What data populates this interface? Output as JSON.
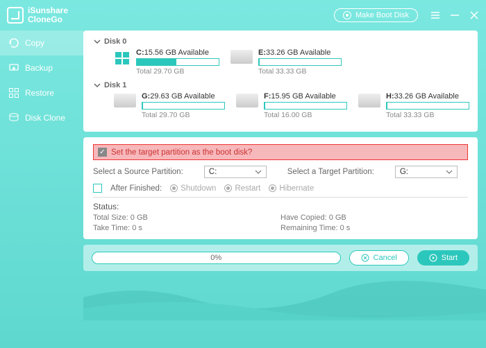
{
  "app": {
    "name_line1": "iSunshare",
    "name_line2": "CloneGo",
    "make_boot": "Make Boot Disk"
  },
  "nav": {
    "copy": "Copy",
    "backup": "Backup",
    "restore": "Restore",
    "diskclone": "Disk Clone"
  },
  "disks": [
    {
      "label": "Disk 0",
      "partitions": [
        {
          "letter": "C:",
          "avail": "15.56 GB Available",
          "total": "Total 29.70 GB",
          "fillPct": 48,
          "isWindows": true
        },
        {
          "letter": "E:",
          "avail": "33.26 GB Available",
          "total": "Total 33.33 GB",
          "fillPct": 1
        }
      ]
    },
    {
      "label": "Disk 1",
      "partitions": [
        {
          "letter": "G:",
          "avail": "29.63 GB Available",
          "total": "Total 29.70 GB",
          "fillPct": 1
        },
        {
          "letter": "F:",
          "avail": "15.95 GB Available",
          "total": "Total 16.00 GB",
          "fillPct": 1
        },
        {
          "letter": "H:",
          "avail": "33.26 GB Available",
          "total": "Total 33.33 GB",
          "fillPct": 1
        }
      ]
    }
  ],
  "config": {
    "boot_checkbox_label": "Set the target partition as the boot disk?",
    "source_label": "Select a Source Partition:",
    "source_value": "C:",
    "target_label": "Select a Target Partition:",
    "target_value": "G:",
    "after_label": "After Finished:",
    "opts": {
      "shutdown": "Shutdown",
      "restart": "Restart",
      "hibernate": "Hibernate"
    }
  },
  "status": {
    "header": "Status:",
    "total_size": "Total Size: 0 GB",
    "have_copied": "Have Copied: 0 GB",
    "take_time": "Take Time: 0 s",
    "remaining_time": "Remaining Time: 0 s"
  },
  "bottom": {
    "progress": "0%",
    "cancel": "Cancel",
    "start": "Start"
  }
}
